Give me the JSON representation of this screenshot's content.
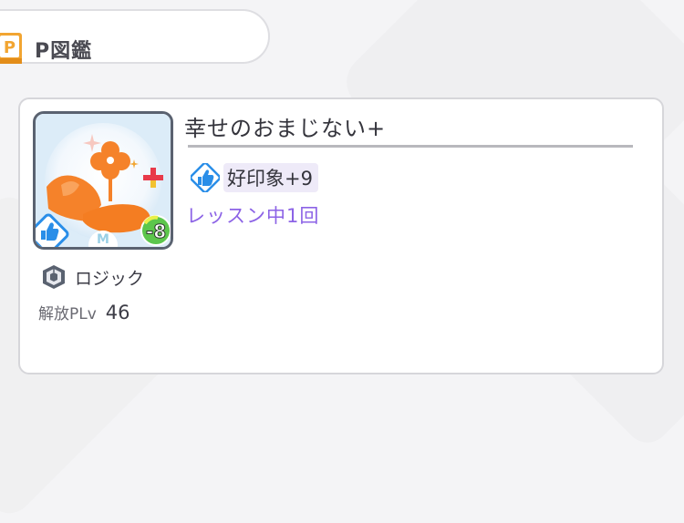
{
  "header": {
    "title": "P図鑑",
    "icon": "book-p-icon"
  },
  "item": {
    "name": "幸せのおまじない+",
    "image": {
      "icon": "clover-charm-image",
      "cost": "-8",
      "badge_letter": "M",
      "type_badge_icon": "thumbs-up-icon"
    },
    "type": {
      "label": "ロジック",
      "icon": "logic-cube-icon"
    },
    "unlock": {
      "label": "解放PLv",
      "value": "46"
    },
    "effect": {
      "icon": "thumbs-up-icon",
      "text": "好印象+9"
    },
    "condition": "レッスン中1回"
  },
  "colors": {
    "accent_purple": "#8c63e6",
    "book_orange": "#f2a531",
    "thumbs_blue": "#2a8ee8",
    "cost_green": "#5cc64c"
  }
}
